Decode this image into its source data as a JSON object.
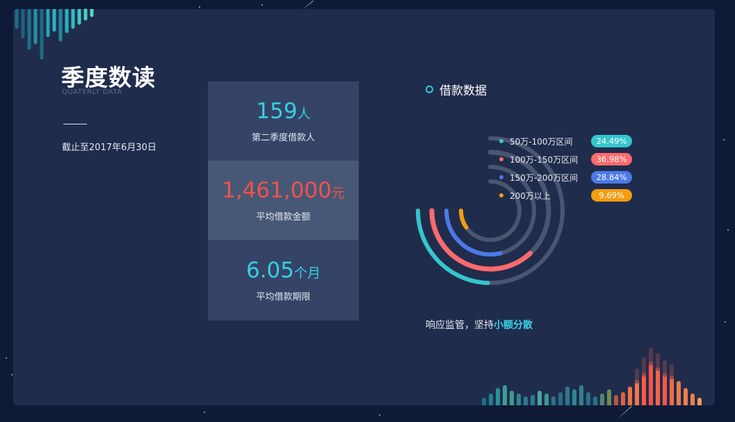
{
  "header": {
    "title": "季度数读",
    "subtitle": "QUATERLY DATA",
    "date_note": "截止至2017年6月30日"
  },
  "stats": [
    {
      "value": "159",
      "unit": "人",
      "label": "第二季度借款人",
      "color": "#36cfe3"
    },
    {
      "value": "1,461,000",
      "unit": "元",
      "label": "平均借款金额",
      "color": "#f4524b"
    },
    {
      "value": "6.05",
      "unit": "个月",
      "label": "平均借款期限",
      "color": "#36cfe3"
    }
  ],
  "loan_panel": {
    "title": "借款数据",
    "rings": [
      {
        "label": "50万-100万区间",
        "percent_label": "24.49%",
        "fraction": 0.2449,
        "color": "#34c6cd"
      },
      {
        "label": "100万-150万区间",
        "percent_label": "36.98%",
        "fraction": 0.3698,
        "color": "#fb6a6c"
      },
      {
        "label": "150万-200万区间",
        "percent_label": "28.84%",
        "fraction": 0.2884,
        "color": "#4b79e8"
      },
      {
        "label": "200万以上",
        "percent_label": "9.69%",
        "fraction": 0.0969,
        "color": "#f39d13"
      }
    ],
    "track_color": "#4a5670"
  },
  "slogan": {
    "prefix": "响应监管，坚持",
    "highlight": "小额分散"
  }
}
